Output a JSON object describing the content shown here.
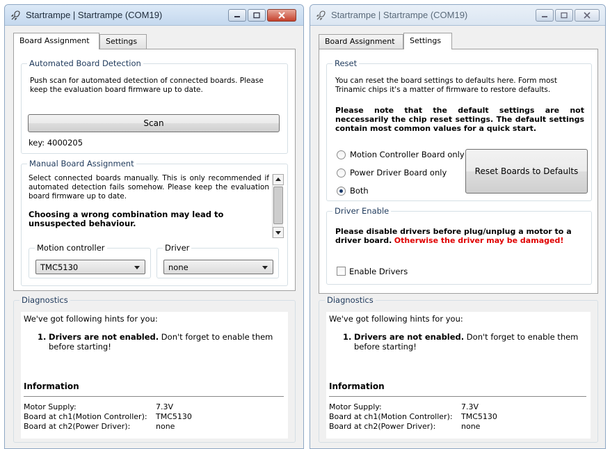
{
  "left_window": {
    "title": "Startrampe | Startrampe (COM19)",
    "tabs": [
      "Board Assignment",
      "Settings"
    ],
    "active_tab": "Board Assignment",
    "auto_detection": {
      "title": "Automated Board Detection",
      "text": "Push scan for automated detection of connected boards. Please keep the evaluation board firmware up to date.",
      "scan_label": "Scan",
      "key_label": "key: 4000205"
    },
    "manual_assignment": {
      "title": "Manual Board Assignment",
      "text": "Select connected boards manually. This is only recommended if automated detection fails somehow.  Please keep the evaluation board firmware up to date.",
      "warning": "Choosing a wrong combination may lead to unsuspected behaviour.",
      "motion_controller_label": "Motion controller",
      "motion_controller_value": "TMC5130",
      "driver_label": "Driver",
      "driver_value": "none"
    }
  },
  "right_window": {
    "title": "Startrampe | Startrampe (COM19)",
    "tabs": [
      "Board Assignment",
      "Settings"
    ],
    "active_tab": "Settings",
    "reset": {
      "title": "Reset",
      "text": "You can reset the board settings to defaults here. Form most Trinamic chips it's a matter of firmware to restore defaults.",
      "note": "Please note that the default settings are not neccessarily the chip reset settings. The default settings contain most common values for a quick start.",
      "options": [
        "Motion Controller Board only",
        "Power Driver Board only",
        "Both"
      ],
      "selected_option": "Both",
      "reset_button_label": "Reset Boards to Defaults"
    },
    "driver_enable": {
      "title": "Driver Enable",
      "warning_black": "Please disable drivers before plug/unplug a motor to a driver board.",
      "warning_red": "Otherwise the driver may be damaged!",
      "enable_drivers_label": "Enable Drivers",
      "enable_drivers_checked": false
    }
  },
  "diagnostics": {
    "title": "Diagnostics",
    "intro": "We've got following hints for you:",
    "hint_number": "1.",
    "hint_bold": "Drivers are not enabled.",
    "hint_rest": " Don't forget to enable them",
    "hint_line2": "before starting!",
    "info_title": "Information",
    "info": [
      {
        "key": "Motor Supply:",
        "value": "7.3V"
      },
      {
        "key": "Board at ch1(Motion Controller):",
        "value": "TMC5130"
      },
      {
        "key": "Board at ch2(Power Driver):",
        "value": "none"
      }
    ]
  },
  "colors": {
    "group_title": "#1e395b",
    "warning_red": "#e00000",
    "close_button": "#c5412c"
  }
}
